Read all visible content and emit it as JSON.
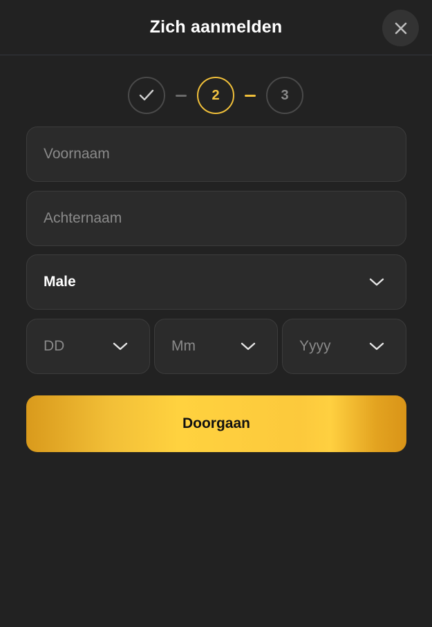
{
  "header": {
    "title": "Zich aanmelden",
    "close_icon": "close-icon"
  },
  "stepper": {
    "steps": [
      {
        "label": "",
        "state": "done",
        "icon": "check-icon"
      },
      {
        "label": "2",
        "state": "active"
      },
      {
        "label": "3",
        "state": "pending"
      }
    ]
  },
  "form": {
    "first_name": {
      "placeholder": "Voornaam",
      "value": ""
    },
    "last_name": {
      "placeholder": "Achternaam",
      "value": ""
    },
    "gender": {
      "value": "Male",
      "icon": "chevron-down-icon"
    },
    "birth_day": {
      "placeholder": "DD",
      "icon": "chevron-down-icon"
    },
    "birth_month": {
      "placeholder": "Mm",
      "icon": "chevron-down-icon"
    },
    "birth_year": {
      "placeholder": "Yyyy",
      "icon": "chevron-down-icon"
    }
  },
  "actions": {
    "continue_label": "Doorgaan"
  },
  "colors": {
    "background": "#222222",
    "field": "#2b2b2b",
    "accent": "#f5c542",
    "text": "#ffffff",
    "placeholder": "#8a8a8a"
  }
}
